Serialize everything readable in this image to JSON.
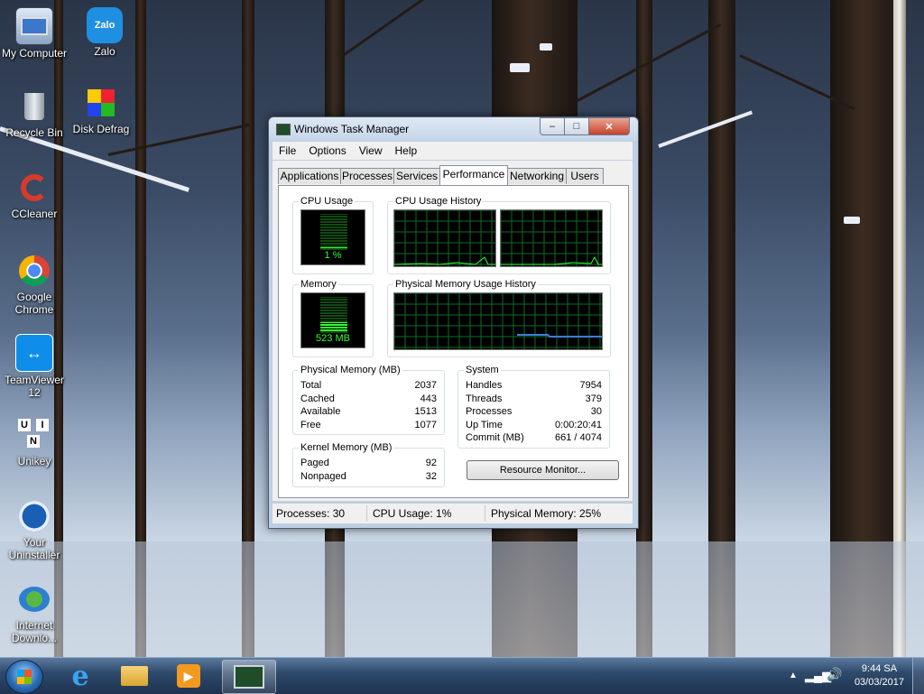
{
  "desktop": {
    "icons": [
      {
        "label": "My Computer",
        "icon": "computer-icon"
      },
      {
        "label": "Zalo",
        "icon": "zalo-icon"
      },
      {
        "label": "Recycle Bin",
        "icon": "recycle-bin-icon"
      },
      {
        "label": "Disk Defrag",
        "icon": "disk-defrag-icon"
      },
      {
        "label": "CCleaner",
        "icon": "ccleaner-icon"
      },
      {
        "label": "Google Chrome",
        "icon": "chrome-icon"
      },
      {
        "label": "TeamViewer 12",
        "icon": "teamviewer-icon"
      },
      {
        "label": "Unikey",
        "icon": "unikey-icon"
      },
      {
        "label": "Your Uninstaller",
        "icon": "uninstaller-icon"
      },
      {
        "label": "Internet Downlo...",
        "icon": "idm-icon"
      }
    ],
    "zalo_text": "Zalo",
    "unikey_letters": [
      "U",
      "I",
      "N"
    ]
  },
  "window": {
    "title": "Windows Task Manager",
    "menu": [
      "File",
      "Options",
      "View",
      "Help"
    ],
    "tabs": [
      "Applications",
      "Processes",
      "Services",
      "Performance",
      "Networking",
      "Users"
    ],
    "active_tab": "Performance",
    "cpu_usage": {
      "label": "CPU Usage",
      "value": "1 %",
      "level": 0.01
    },
    "cpu_history": {
      "label": "CPU Usage History"
    },
    "memory": {
      "label": "Memory",
      "value": "523 MB",
      "level": 0.25
    },
    "mem_history": {
      "label": "Physical Memory Usage History"
    },
    "physical_memory": {
      "label": "Physical Memory (MB)",
      "rows": [
        {
          "k": "Total",
          "v": "2037"
        },
        {
          "k": "Cached",
          "v": "443"
        },
        {
          "k": "Available",
          "v": "1513"
        },
        {
          "k": "Free",
          "v": "1077"
        }
      ]
    },
    "kernel_memory": {
      "label": "Kernel Memory (MB)",
      "rows": [
        {
          "k": "Paged",
          "v": "92"
        },
        {
          "k": "Nonpaged",
          "v": "32"
        }
      ]
    },
    "system": {
      "label": "System",
      "rows": [
        {
          "k": "Handles",
          "v": "7954"
        },
        {
          "k": "Threads",
          "v": "379"
        },
        {
          "k": "Processes",
          "v": "30"
        },
        {
          "k": "Up Time",
          "v": "0:00:20:41"
        },
        {
          "k": "Commit (MB)",
          "v": "661 / 4074"
        }
      ]
    },
    "resource_monitor_button": "Resource Monitor...",
    "status": {
      "processes": "Processes: 30",
      "cpu": "CPU Usage: 1%",
      "memory": "Physical Memory: 25%"
    },
    "colors": {
      "graph_line": "#33ff33",
      "grid": "#0b6b2b",
      "mem_line": "#3a7fd8"
    }
  },
  "taskbar": {
    "pinned": [
      "internet-explorer-icon",
      "file-explorer-icon",
      "media-player-icon",
      "task-manager-icon"
    ],
    "clock_time": "9:44 SA",
    "clock_date": "03/03/2017"
  }
}
